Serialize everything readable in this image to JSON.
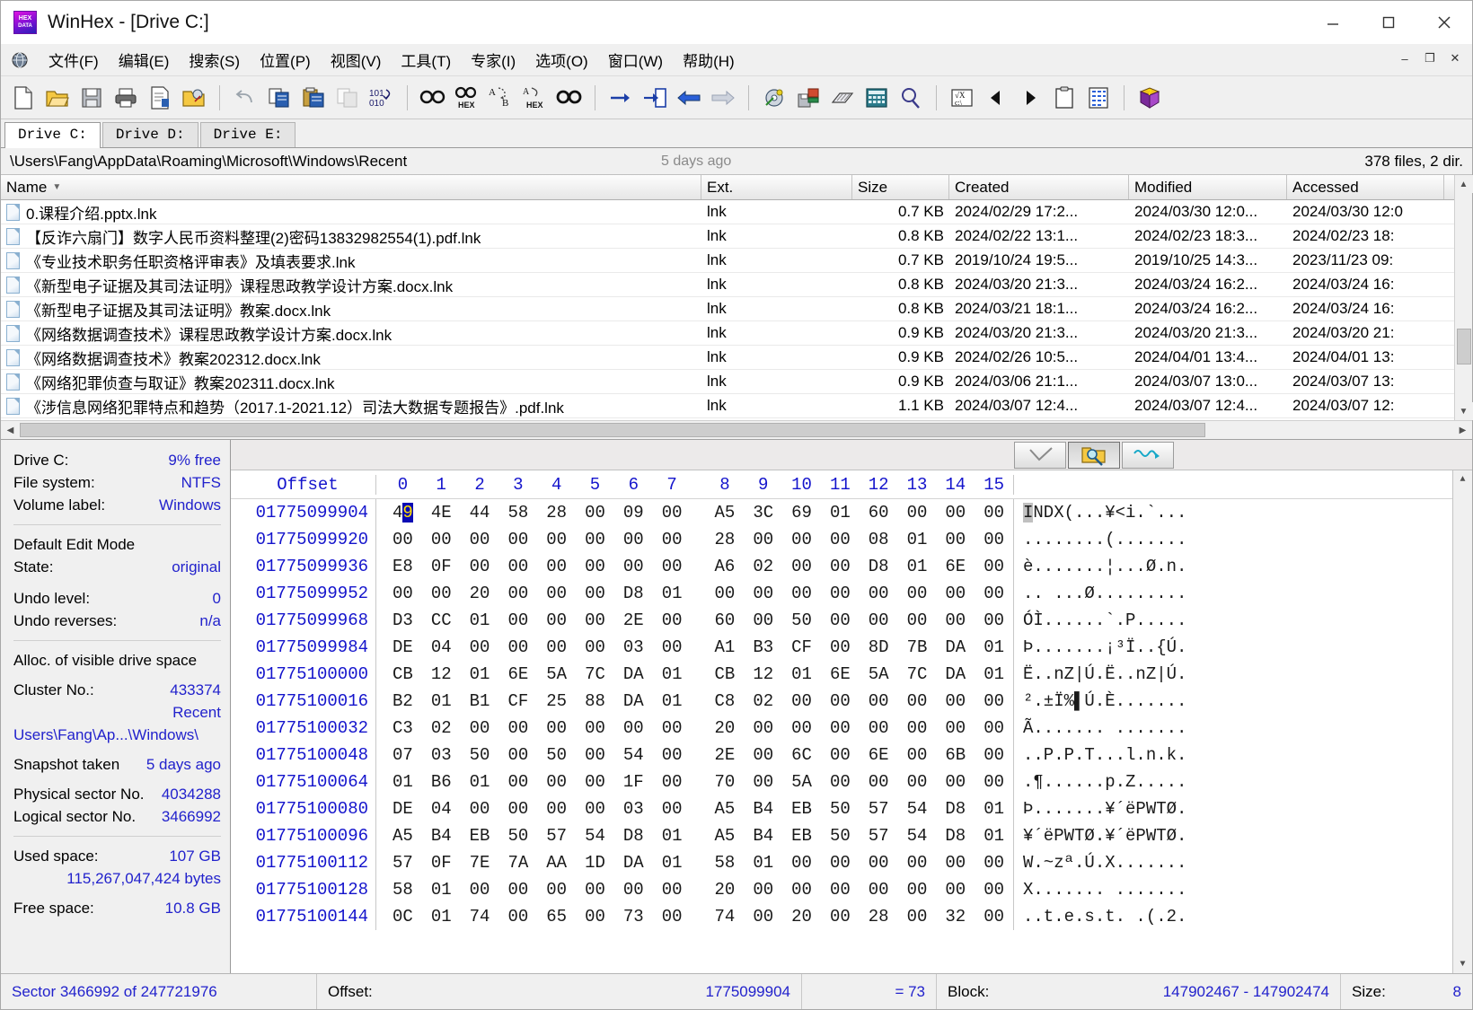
{
  "window": {
    "title": "WinHex - [Drive C:]",
    "app_icon": "hex-app-icon",
    "minimize_label": "Minimize",
    "maximize_label": "Maximize",
    "close_label": "Close"
  },
  "menubar": {
    "globe_icon": "globe-icon",
    "items": [
      {
        "label": "文件(F)",
        "accel": "F"
      },
      {
        "label": "编辑(E)",
        "accel": "E"
      },
      {
        "label": "搜索(S)",
        "accel": "S"
      },
      {
        "label": "位置(P)",
        "accel": "P"
      },
      {
        "label": "视图(V)",
        "accel": "V"
      },
      {
        "label": "工具(T)",
        "accel": "T"
      },
      {
        "label": "专家(I)",
        "accel": "I"
      },
      {
        "label": "选项(O)",
        "accel": "O"
      },
      {
        "label": "窗口(W)",
        "accel": "W"
      },
      {
        "label": "帮助(H)",
        "accel": "H"
      }
    ],
    "mdi_minimize": "–",
    "mdi_restore": "❐",
    "mdi_close": "✕"
  },
  "toolbar": {
    "icons": [
      "new-file-icon",
      "open-folder-icon",
      "save-icon",
      "print-icon",
      "file-properties-icon",
      "open-disk-icon",
      "undo-icon",
      "copy-icon",
      "paste-icon",
      "copy-dim-icon",
      "binary-convert-icon",
      "find-text-icon",
      "find-hex-icon",
      "replace-text-icon",
      "replace-hex-icon",
      "find-again-icon",
      "goto-offset-icon",
      "goto-sector-icon",
      "back-icon",
      "forward-icon",
      "disk-tool-icon",
      "clone-disk-icon",
      "wipe-icon",
      "calculator-icon",
      "search-icon",
      "analyze-icon",
      "prev-icon",
      "next-icon",
      "clipboard-icon",
      "table-icon",
      "help-icon"
    ]
  },
  "drive_tabs": {
    "items": [
      {
        "label": "Drive C:",
        "active": true
      },
      {
        "label": "Drive D:",
        "active": false
      },
      {
        "label": "Drive E:",
        "active": false
      }
    ]
  },
  "pathbar": {
    "path": "\\Users\\Fang\\AppData\\Roaming\\Microsoft\\Windows\\Recent",
    "snapshot_age": "5 days ago",
    "file_count": "378 files, 2 dir."
  },
  "filelist": {
    "columns": [
      {
        "key": "name",
        "label": "Name",
        "sorted": true,
        "sort_icon": "sort-desc-icon"
      },
      {
        "key": "ext",
        "label": "Ext."
      },
      {
        "key": "size",
        "label": "Size"
      },
      {
        "key": "created",
        "label": "Created"
      },
      {
        "key": "modified",
        "label": "Modified"
      },
      {
        "key": "accessed",
        "label": "Accessed"
      }
    ],
    "rows": [
      {
        "icon": "file-icon",
        "name": "0.课程介绍.pptx.lnk",
        "ext": "lnk",
        "size": "0.7 KB",
        "created": "2024/02/29  17:2...",
        "modified": "2024/03/30  12:0...",
        "accessed": "2024/03/30  12:0"
      },
      {
        "icon": "file-icon",
        "name": "【反诈六扇门】数字人民币资料整理(2)密码13832982554(1).pdf.lnk",
        "ext": "lnk",
        "size": "0.8 KB",
        "created": "2024/02/22  13:1...",
        "modified": "2024/02/23  18:3...",
        "accessed": "2024/02/23  18:"
      },
      {
        "icon": "file-icon",
        "name": "《专业技术职务任职资格评审表》及填表要求.lnk",
        "ext": "lnk",
        "size": "0.7 KB",
        "created": "2019/10/24  19:5...",
        "modified": "2019/10/25  14:3...",
        "accessed": "2023/11/23  09:"
      },
      {
        "icon": "file-icon",
        "name": "《新型电子证据及其司法证明》课程思政教学设计方案.docx.lnk",
        "ext": "lnk",
        "size": "0.8 KB",
        "created": "2024/03/20  21:3...",
        "modified": "2024/03/24  16:2...",
        "accessed": "2024/03/24  16:"
      },
      {
        "icon": "file-icon",
        "name": "《新型电子证据及其司法证明》教案.docx.lnk",
        "ext": "lnk",
        "size": "0.8 KB",
        "created": "2024/03/21  18:1...",
        "modified": "2024/03/24  16:2...",
        "accessed": "2024/03/24  16:"
      },
      {
        "icon": "file-icon",
        "name": "《网络数据调查技术》课程思政教学设计方案.docx.lnk",
        "ext": "lnk",
        "size": "0.9 KB",
        "created": "2024/03/20  21:3...",
        "modified": "2024/03/20  21:3...",
        "accessed": "2024/03/20  21:"
      },
      {
        "icon": "file-icon",
        "name": "《网络数据调查技术》教案202312.docx.lnk",
        "ext": "lnk",
        "size": "0.9 KB",
        "created": "2024/02/26  10:5...",
        "modified": "2024/04/01  13:4...",
        "accessed": "2024/04/01  13:"
      },
      {
        "icon": "file-icon",
        "name": "《网络犯罪侦查与取证》教案202311.docx.lnk",
        "ext": "lnk",
        "size": "0.9 KB",
        "created": "2024/03/06  21:1...",
        "modified": "2024/03/07  13:0...",
        "accessed": "2024/03/07  13:"
      },
      {
        "icon": "file-icon",
        "name": "《涉信息网络犯罪特点和趋势（2017.1-2021.12）司法大数据专题报告》.pdf.lnk",
        "ext": "lnk",
        "size": "1.1 KB",
        "created": "2024/03/07  12:4...",
        "modified": "2024/03/07  12:4...",
        "accessed": "2024/03/07  12:"
      }
    ]
  },
  "infopanel": {
    "group1": [
      {
        "key": "Drive C:",
        "value": "9% free"
      },
      {
        "key": "File system:",
        "value": "NTFS"
      },
      {
        "key": "Volume label:",
        "value": "Windows"
      }
    ],
    "edit_mode_heading": "Default Edit Mode",
    "group2": [
      {
        "key": "State:",
        "value": "original"
      }
    ],
    "group3": [
      {
        "key": "Undo level:",
        "value": "0"
      },
      {
        "key": "Undo reverses:",
        "value": "n/a"
      }
    ],
    "alloc_heading": "Alloc. of visible drive space",
    "group4": [
      {
        "key": "Cluster No.:",
        "value": "433374"
      }
    ],
    "cluster_name": "Recent",
    "cluster_path": "Users\\Fang\\Ap...\\Windows\\",
    "group5": [
      {
        "key": "Snapshot taken",
        "value": "5 days ago"
      }
    ],
    "group6": [
      {
        "key": "Physical sector No.",
        "value": "4034288"
      },
      {
        "key": "Logical sector No.",
        "value": "3466992"
      }
    ],
    "group7": [
      {
        "key": "Used space:",
        "value": "107 GB"
      }
    ],
    "used_bytes": "115,267,047,424 bytes",
    "group8": [
      {
        "key": "Free space:",
        "value": "10.8 GB"
      }
    ]
  },
  "hexview": {
    "mode_buttons": [
      {
        "icon": "checkmark-icon",
        "pressed": false,
        "name": "edit-mode-button"
      },
      {
        "icon": "folder-search-icon",
        "pressed": true,
        "name": "view-mode-button"
      },
      {
        "icon": "squiggle-arrow-icon",
        "pressed": false,
        "name": "interpret-mode-button"
      }
    ],
    "offset_header": "Offset",
    "column_headers": [
      "0",
      "1",
      "2",
      "3",
      "4",
      "5",
      "6",
      "7",
      "8",
      "9",
      "10",
      "11",
      "12",
      "13",
      "14",
      "15"
    ],
    "selection": {
      "row": 0,
      "byte": 0,
      "nibble": "low"
    },
    "rows": [
      {
        "offset": "01775099904",
        "bytes": [
          "49",
          "4E",
          "44",
          "58",
          "28",
          "00",
          "09",
          "00",
          "A5",
          "3C",
          "69",
          "01",
          "60",
          "00",
          "00",
          "00"
        ],
        "ascii": "INDX(...¥<i.`..."
      },
      {
        "offset": "01775099920",
        "bytes": [
          "00",
          "00",
          "00",
          "00",
          "00",
          "00",
          "00",
          "00",
          "28",
          "00",
          "00",
          "00",
          "08",
          "01",
          "00",
          "00"
        ],
        "ascii": "........(......."
      },
      {
        "offset": "01775099936",
        "bytes": [
          "E8",
          "0F",
          "00",
          "00",
          "00",
          "00",
          "00",
          "00",
          "A6",
          "02",
          "00",
          "00",
          "D8",
          "01",
          "6E",
          "00"
        ],
        "ascii": "è.......¦...Ø.n."
      },
      {
        "offset": "01775099952",
        "bytes": [
          "00",
          "00",
          "20",
          "00",
          "00",
          "00",
          "D8",
          "01",
          "00",
          "00",
          "00",
          "00",
          "00",
          "00",
          "00",
          "00"
        ],
        "ascii": ".. ...Ø........."
      },
      {
        "offset": "01775099968",
        "bytes": [
          "D3",
          "CC",
          "01",
          "00",
          "00",
          "00",
          "2E",
          "00",
          "60",
          "00",
          "50",
          "00",
          "00",
          "00",
          "00",
          "00"
        ],
        "ascii": "ÓÌ......`.P....."
      },
      {
        "offset": "01775099984",
        "bytes": [
          "DE",
          "04",
          "00",
          "00",
          "00",
          "00",
          "03",
          "00",
          "A1",
          "B3",
          "CF",
          "00",
          "8D",
          "7B",
          "DA",
          "01"
        ],
        "ascii": "Þ.......¡³Ï..{Ú."
      },
      {
        "offset": "01775100000",
        "bytes": [
          "CB",
          "12",
          "01",
          "6E",
          "5A",
          "7C",
          "DA",
          "01",
          "CB",
          "12",
          "01",
          "6E",
          "5A",
          "7C",
          "DA",
          "01"
        ],
        "ascii": "Ë..nZ|Ú.Ë..nZ|Ú."
      },
      {
        "offset": "01775100016",
        "bytes": [
          "B2",
          "01",
          "B1",
          "CF",
          "25",
          "88",
          "DA",
          "01",
          "C8",
          "02",
          "00",
          "00",
          "00",
          "00",
          "00",
          "00"
        ],
        "ascii": "².±Ï%▌Ú.È......."
      },
      {
        "offset": "01775100032",
        "bytes": [
          "C3",
          "02",
          "00",
          "00",
          "00",
          "00",
          "00",
          "00",
          "20",
          "00",
          "00",
          "00",
          "00",
          "00",
          "00",
          "00"
        ],
        "ascii": "Ã....... ......."
      },
      {
        "offset": "01775100048",
        "bytes": [
          "07",
          "03",
          "50",
          "00",
          "50",
          "00",
          "54",
          "00",
          "2E",
          "00",
          "6C",
          "00",
          "6E",
          "00",
          "6B",
          "00"
        ],
        "ascii": "..P.P.T...l.n.k."
      },
      {
        "offset": "01775100064",
        "bytes": [
          "01",
          "B6",
          "01",
          "00",
          "00",
          "00",
          "1F",
          "00",
          "70",
          "00",
          "5A",
          "00",
          "00",
          "00",
          "00",
          "00"
        ],
        "ascii": ".¶......p.Z....."
      },
      {
        "offset": "01775100080",
        "bytes": [
          "DE",
          "04",
          "00",
          "00",
          "00",
          "00",
          "03",
          "00",
          "A5",
          "B4",
          "EB",
          "50",
          "57",
          "54",
          "D8",
          "01"
        ],
        "ascii": "Þ.......¥´ëPWTØ."
      },
      {
        "offset": "01775100096",
        "bytes": [
          "A5",
          "B4",
          "EB",
          "50",
          "57",
          "54",
          "D8",
          "01",
          "A5",
          "B4",
          "EB",
          "50",
          "57",
          "54",
          "D8",
          "01"
        ],
        "ascii": "¥´ëPWTØ.¥´ëPWTØ."
      },
      {
        "offset": "01775100112",
        "bytes": [
          "57",
          "0F",
          "7E",
          "7A",
          "AA",
          "1D",
          "DA",
          "01",
          "58",
          "01",
          "00",
          "00",
          "00",
          "00",
          "00",
          "00"
        ],
        "ascii": "W.~zª.Ú.X......."
      },
      {
        "offset": "01775100128",
        "bytes": [
          "58",
          "01",
          "00",
          "00",
          "00",
          "00",
          "00",
          "00",
          "20",
          "00",
          "00",
          "00",
          "00",
          "00",
          "00",
          "00"
        ],
        "ascii": "X....... ......."
      },
      {
        "offset": "01775100144",
        "bytes": [
          "0C",
          "01",
          "74",
          "00",
          "65",
          "00",
          "73",
          "00",
          "74",
          "00",
          "20",
          "00",
          "28",
          "00",
          "32",
          "00"
        ],
        "ascii": "..t.e.s.t. .(.2."
      }
    ]
  },
  "statusbar": {
    "sector_text": "Sector 3466992 of 247721976",
    "offset_label": "Offset:",
    "offset_value": "1775099904",
    "equals_value": "= 73",
    "block_label": "Block:",
    "block_value": "147902467 - 147902474",
    "size_label": "Size:",
    "size_value": "8"
  }
}
